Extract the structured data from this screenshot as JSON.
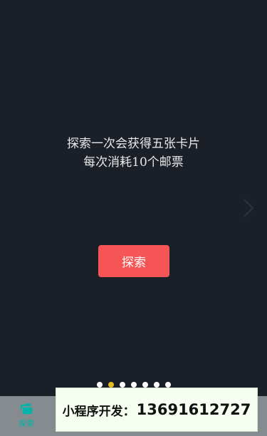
{
  "info": {
    "line1": "探索一次会获得五张卡片",
    "line2": "每次消耗10个邮票"
  },
  "explore_button": {
    "label": "探索"
  },
  "pager": {
    "total": 7,
    "active_index": 1
  },
  "tabbar": {
    "items": [
      {
        "label": "探索",
        "icon": "cards-icon",
        "active": true
      }
    ]
  },
  "banner": {
    "label": "小程序开发：",
    "phone": "13691612727"
  },
  "colors": {
    "background": "#1b2028",
    "button": "#f55555",
    "active_dot": "#e8b923",
    "tab_active": "#00b4a8",
    "tabbar": "#858b8f"
  }
}
